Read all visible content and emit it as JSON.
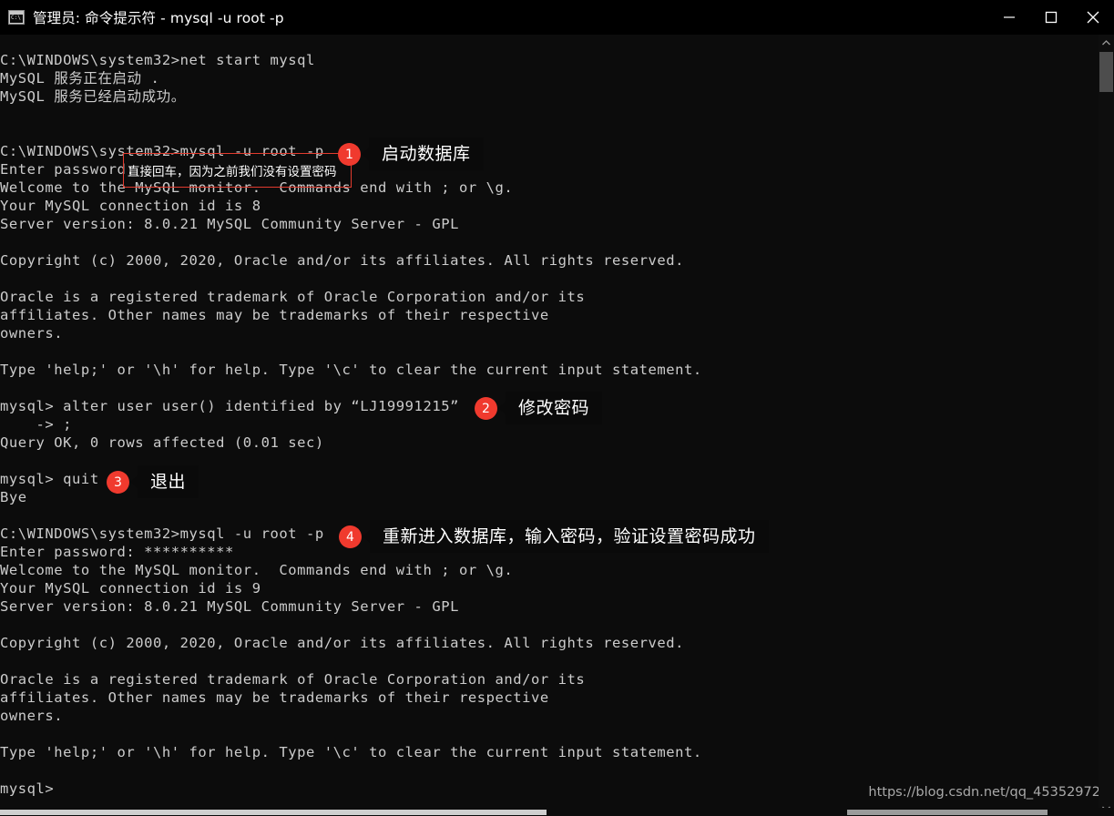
{
  "window": {
    "title": "管理员: 命令提示符 - mysql  -u root -p",
    "icon": "cmd-icon",
    "controls": {
      "minimize": "minimize-icon",
      "maximize": "maximize-icon",
      "close": "close-icon"
    }
  },
  "terminal": {
    "lines": [
      "C:\\WINDOWS\\system32>net start mysql",
      "MySQL 服务正在启动 .",
      "MySQL 服务已经启动成功。",
      "",
      "",
      "C:\\WINDOWS\\system32>mysql -u root -p",
      "Enter password:",
      "Welcome to the MySQL monitor.  Commands end with ; or \\g.",
      "Your MySQL connection id is 8",
      "Server version: 8.0.21 MySQL Community Server - GPL",
      "",
      "Copyright (c) 2000, 2020, Oracle and/or its affiliates. All rights reserved.",
      "",
      "Oracle is a registered trademark of Oracle Corporation and/or its",
      "affiliates. Other names may be trademarks of their respective",
      "owners.",
      "",
      "Type 'help;' or '\\h' for help. Type '\\c' to clear the current input statement.",
      "",
      "mysql> alter user user() identified by “LJ19991215”",
      "    -> ;",
      "Query OK, 0 rows affected (0.01 sec)",
      "",
      "mysql> quit",
      "Bye",
      "",
      "C:\\WINDOWS\\system32>mysql -u root -p",
      "Enter password: **********",
      "Welcome to the MySQL monitor.  Commands end with ; or \\g.",
      "Your MySQL connection id is 9",
      "Server version: 8.0.21 MySQL Community Server - GPL",
      "",
      "Copyright (c) 2000, 2020, Oracle and/or its affiliates. All rights reserved.",
      "",
      "Oracle is a registered trademark of Oracle Corporation and/or its",
      "affiliates. Other names may be trademarks of their respective",
      "owners.",
      "",
      "Type 'help;' or '\\h' for help. Type '\\c' to clear the current input statement.",
      "",
      "mysql>"
    ]
  },
  "annotations": {
    "inline_note": "直接回车，因为之前我们没有设置密码",
    "steps": [
      {
        "number": "1",
        "label": "启动数据库"
      },
      {
        "number": "2",
        "label": "修改密码"
      },
      {
        "number": "3",
        "label": "退出"
      },
      {
        "number": "4",
        "label": "重新进入数据库，输入密码，验证设置密码成功"
      }
    ],
    "accent_color": "#f03a2e"
  },
  "watermark": {
    "text": "https://blog.csdn.net/qq_45352972"
  }
}
